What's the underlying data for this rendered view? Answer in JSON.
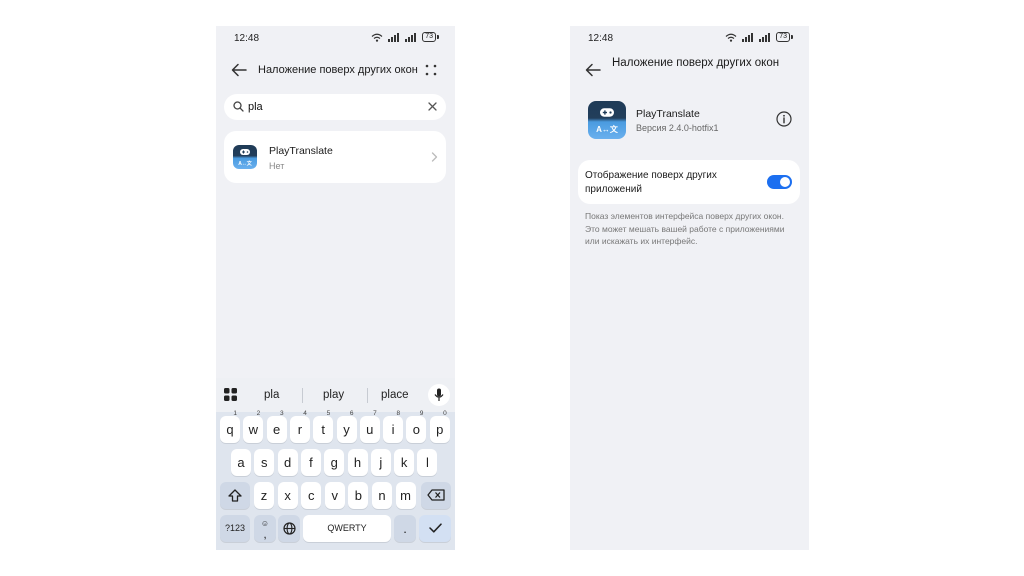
{
  "left_phone": {
    "status": {
      "time": "12:48",
      "battery": "73"
    },
    "title": "Наложение поверх других окон",
    "search": {
      "value": "pla"
    },
    "result": {
      "name": "PlayTranslate",
      "status": "Нет"
    },
    "keyboard": {
      "suggestions": [
        "pla",
        "play",
        "place"
      ],
      "row1": [
        {
          "k": "q",
          "h": "1"
        },
        {
          "k": "w",
          "h": "2"
        },
        {
          "k": "e",
          "h": "3"
        },
        {
          "k": "r",
          "h": "4"
        },
        {
          "k": "t",
          "h": "5"
        },
        {
          "k": "y",
          "h": "6"
        },
        {
          "k": "u",
          "h": "7"
        },
        {
          "k": "i",
          "h": "8"
        },
        {
          "k": "o",
          "h": "9"
        },
        {
          "k": "p",
          "h": "0"
        }
      ],
      "row2": [
        "a",
        "s",
        "d",
        "f",
        "g",
        "h",
        "j",
        "k",
        "l"
      ],
      "row3": [
        "z",
        "x",
        "c",
        "v",
        "b",
        "n",
        "m"
      ],
      "symbols_key": "?123",
      "emoji_comma": ",",
      "space_label": "QWERTY",
      "period_key": "."
    }
  },
  "right_phone": {
    "status": {
      "time": "12:48",
      "battery": "73"
    },
    "title": "Наложение поверх других окон",
    "app": {
      "name": "PlayTranslate",
      "version": "Версия 2.4.0-hotfix1"
    },
    "toggle": {
      "label": "Отображение поверх других приложений",
      "enabled": true
    },
    "description": "Показ элементов интерфейса поверх других окон. Это может мешать вашей работе с приложениями или искажать их интерфейс."
  },
  "app_icon_text": "A↔文",
  "colors": {
    "accent": "#1c6ff0",
    "background": "#f0f1f5",
    "keyboard": "#dfe5ee"
  },
  "icons": [
    "wifi-icon",
    "signal-icon",
    "battery-icon",
    "back-arrow-icon",
    "more-icon",
    "search-icon",
    "clear-icon",
    "chevron-right-icon",
    "apps-grid-icon",
    "mic-icon",
    "shift-icon",
    "backspace-icon",
    "globe-icon",
    "check-icon",
    "info-icon",
    "gamepad-icon"
  ]
}
